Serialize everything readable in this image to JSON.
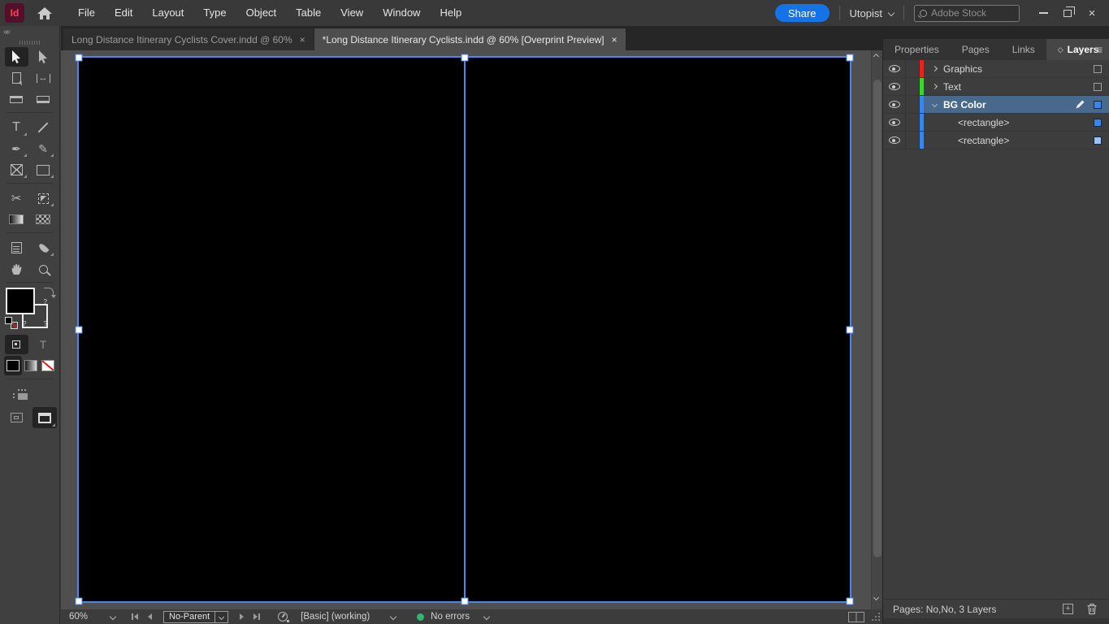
{
  "app": {
    "logo_text": "Id",
    "menus": [
      "File",
      "Edit",
      "Layout",
      "Type",
      "Object",
      "Table",
      "View",
      "Window",
      "Help"
    ],
    "share_label": "Share",
    "workspace_label": "Utopist",
    "stock_search_placeholder": "Adobe Stock"
  },
  "tabs": [
    {
      "label": "Long Distance Itinerary Cyclists Cover.indd @ 60%",
      "active": false
    },
    {
      "label": "*Long Distance Itinerary Cyclists.indd @ 60%  [Overprint Preview]",
      "active": true
    }
  ],
  "toolbar": {
    "tools": [
      "selection",
      "direct-selection",
      "page",
      "gap",
      "content-collector",
      "content-placer",
      "type",
      "line",
      "pen",
      "pencil",
      "frame",
      "rectangle",
      "scissors",
      "free-transform",
      "gradient-swatch",
      "gradient-feather",
      "note",
      "color-theme",
      "hand",
      "zoom"
    ],
    "active_tool": "selection",
    "fill_color": "#000000"
  },
  "panel": {
    "tabs": [
      "Properties",
      "Pages",
      "Links",
      "Layers"
    ],
    "active_tab": "Layers",
    "layers": [
      {
        "name": "Graphics",
        "color": "#e3251f",
        "expanded": false,
        "selected": false
      },
      {
        "name": "Text",
        "color": "#3ed52f",
        "expanded": false,
        "selected": false
      },
      {
        "name": "BG Color",
        "color": "#3a85e8",
        "expanded": true,
        "selected": true
      },
      {
        "name": "<rectangle>",
        "color": "#3a85e8",
        "child": true
      },
      {
        "name": "<rectangle>",
        "color": "#3a85e8",
        "child": true
      }
    ],
    "footer_text": "Pages: No,No, 3 Layers"
  },
  "statusbar": {
    "zoom_level": "60%",
    "parent_page": "No-Parent",
    "preflight_profile": "[Basic] (working)",
    "preflight_status": "No errors"
  },
  "icons": {
    "close": "×",
    "menu": "≡",
    "collapse_left": "««",
    "gap": "↔",
    "type": "T",
    "type_small": "T",
    "scissors": "✂",
    "pencil": "✎",
    "pen": "✒",
    "question": "?",
    "plus": "+",
    "diamond": "◇"
  },
  "colors": {
    "accent_blue": "#1473e6",
    "selection_blue": "#4788f0",
    "status_green": "#2eb872",
    "selected_row": "#48688c",
    "layer_red": "#e3251f",
    "layer_green": "#3ed52f",
    "layer_blue": "#3a85e8"
  }
}
